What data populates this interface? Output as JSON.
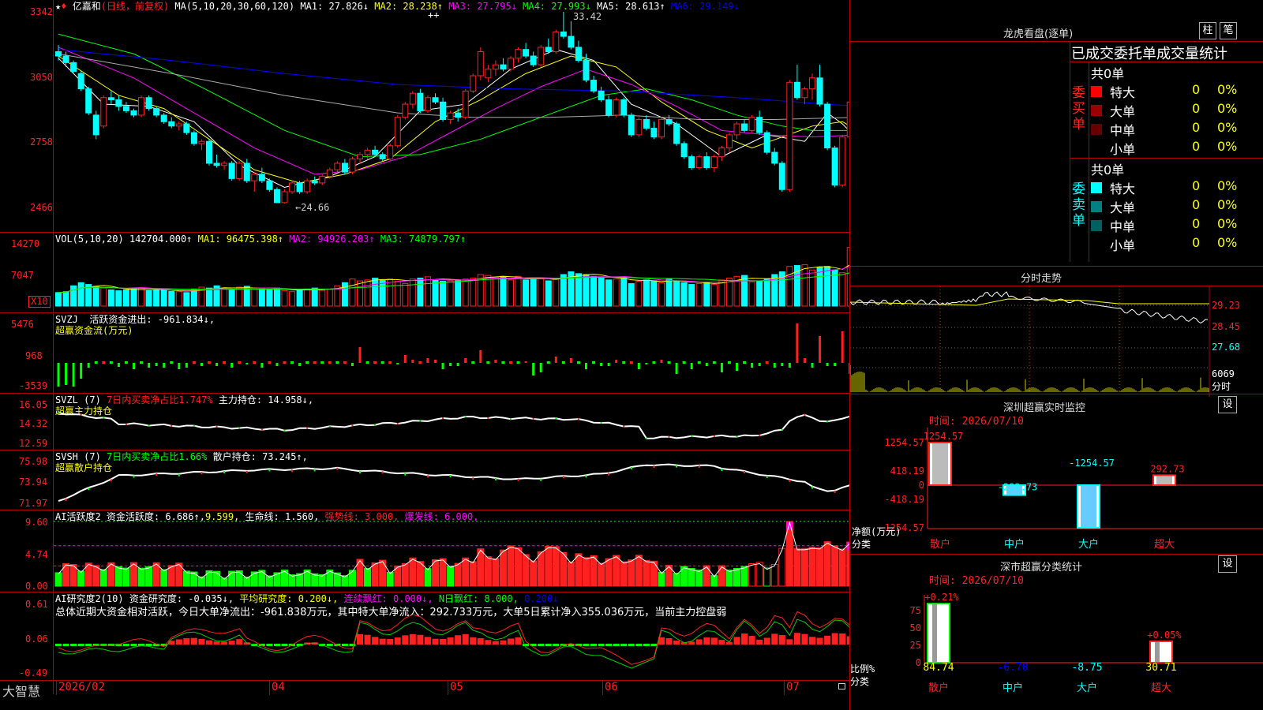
{
  "stock": {
    "name": "亿嘉和",
    "period": "(日线，前复权)",
    "ma_label": "MA(5,10,20,30,60,120)",
    "ma": [
      {
        "label": "MA1: 27.826↓",
        "color": "#ffffff"
      },
      {
        "label": "MA2: 28.238↑",
        "color": "#ffff00"
      },
      {
        "label": "MA3: 27.795↓",
        "color": "#ff00ff"
      },
      {
        "label": "MA4: 27.993↓",
        "color": "#00ff00"
      },
      {
        "label": "MA5: 28.613↑",
        "color": "#ffffff"
      },
      {
        "label": "MA6: 29.149↓",
        "color": "#0000ff"
      }
    ],
    "high_mark": "33.42",
    "low_mark": "←24.66"
  },
  "price_axis": [
    "3342",
    "3050",
    "2758",
    "2466"
  ],
  "price_chart": {
    "candles": [
      [
        31.6,
        31.9,
        31.2,
        31.4
      ],
      [
        31.4,
        31.6,
        30.9,
        31.1
      ],
      [
        31.1,
        31.2,
        30.6,
        30.7
      ],
      [
        30.6,
        30.7,
        29.8,
        29.9
      ],
      [
        29.9,
        30.0,
        28.7,
        28.8
      ],
      [
        28.7,
        28.9,
        27.6,
        27.8
      ],
      [
        28.2,
        29.6,
        28.1,
        29.5
      ],
      [
        29.5,
        29.8,
        29.2,
        29.4
      ],
      [
        29.4,
        29.6,
        28.9,
        29.1
      ],
      [
        29.1,
        29.3,
        28.8,
        28.9
      ],
      [
        28.9,
        29.0,
        28.6,
        28.7
      ],
      [
        28.7,
        29.6,
        28.6,
        29.5
      ],
      [
        29.5,
        29.6,
        28.9,
        29.0
      ],
      [
        29.0,
        29.1,
        28.6,
        28.7
      ],
      [
        28.7,
        28.8,
        28.3,
        28.4
      ],
      [
        28.4,
        28.6,
        28.1,
        28.2
      ],
      [
        28.2,
        28.4,
        28.0,
        28.3
      ],
      [
        28.3,
        28.4,
        27.8,
        27.9
      ],
      [
        27.9,
        28.0,
        27.3,
        27.4
      ],
      [
        27.4,
        27.6,
        27.1,
        27.5
      ],
      [
        27.5,
        27.6,
        26.4,
        26.5
      ],
      [
        26.5,
        26.9,
        26.3,
        26.4
      ],
      [
        26.4,
        26.6,
        26.2,
        26.5
      ],
      [
        26.5,
        26.6,
        25.7,
        25.8
      ],
      [
        25.8,
        26.6,
        25.7,
        26.5
      ],
      [
        26.5,
        26.7,
        25.6,
        25.7
      ],
      [
        25.7,
        26.1,
        25.2,
        26.0
      ],
      [
        26.0,
        26.3,
        25.6,
        25.7
      ],
      [
        25.7,
        25.8,
        25.2,
        25.3
      ],
      [
        25.3,
        25.4,
        24.7,
        24.7
      ],
      [
        24.7,
        25.3,
        24.66,
        25.2
      ],
      [
        25.2,
        25.7,
        25.1,
        25.6
      ],
      [
        25.6,
        25.7,
        25.1,
        25.2
      ],
      [
        25.2,
        25.8,
        25.1,
        25.7
      ],
      [
        25.7,
        25.9,
        25.5,
        25.6
      ],
      [
        25.6,
        26.0,
        25.5,
        25.9
      ],
      [
        25.9,
        26.3,
        25.8,
        26.2
      ],
      [
        26.2,
        26.6,
        26.1,
        26.5
      ],
      [
        26.5,
        26.7,
        26.0,
        26.1
      ],
      [
        26.1,
        26.8,
        26.0,
        26.7
      ],
      [
        26.7,
        27.0,
        26.5,
        26.9
      ],
      [
        26.9,
        27.2,
        26.7,
        27.1
      ],
      [
        27.1,
        27.3,
        26.8,
        26.9
      ],
      [
        26.9,
        27.0,
        26.6,
        26.7
      ],
      [
        26.7,
        27.4,
        26.6,
        27.3
      ],
      [
        27.3,
        28.7,
        27.2,
        28.6
      ],
      [
        28.6,
        29.3,
        28.5,
        29.2
      ],
      [
        29.2,
        29.8,
        29.0,
        29.7
      ],
      [
        29.7,
        29.9,
        28.8,
        28.9
      ],
      [
        28.9,
        29.6,
        28.8,
        29.5
      ],
      [
        29.5,
        29.7,
        29.2,
        29.3
      ],
      [
        29.3,
        29.5,
        28.4,
        28.5
      ],
      [
        28.5,
        28.9,
        28.3,
        28.8
      ],
      [
        28.8,
        29.0,
        28.4,
        28.6
      ],
      [
        28.6,
        29.9,
        28.5,
        29.8
      ],
      [
        29.8,
        30.6,
        29.7,
        30.5
      ],
      [
        30.5,
        31.8,
        30.3,
        31.6
      ],
      [
        30.4,
        31.0,
        30.2,
        30.8
      ],
      [
        30.8,
        31.2,
        30.5,
        31.0
      ],
      [
        31.0,
        31.3,
        30.7,
        30.8
      ],
      [
        30.8,
        31.4,
        30.7,
        31.3
      ],
      [
        31.3,
        31.8,
        31.1,
        31.7
      ],
      [
        31.7,
        32.0,
        31.3,
        31.4
      ],
      [
        31.4,
        31.6,
        30.9,
        31.0
      ],
      [
        31.0,
        31.9,
        30.9,
        31.8
      ],
      [
        31.8,
        32.2,
        31.5,
        31.6
      ],
      [
        31.6,
        32.6,
        31.5,
        32.5
      ],
      [
        32.5,
        33.42,
        32.2,
        32.3
      ],
      [
        32.3,
        33.0,
        31.7,
        31.8
      ],
      [
        31.8,
        32.1,
        31.1,
        31.2
      ],
      [
        31.2,
        31.5,
        30.2,
        30.3
      ],
      [
        30.3,
        30.5,
        29.7,
        29.8
      ],
      [
        29.8,
        30.0,
        29.3,
        29.4
      ],
      [
        29.4,
        29.6,
        28.6,
        28.7
      ],
      [
        28.7,
        29.5,
        28.6,
        29.4
      ],
      [
        29.4,
        29.5,
        28.6,
        28.7
      ],
      [
        28.7,
        28.8,
        27.7,
        27.8
      ],
      [
        27.8,
        28.6,
        27.7,
        28.5
      ],
      [
        28.5,
        28.7,
        28.0,
        28.1
      ],
      [
        28.1,
        28.4,
        27.6,
        27.7
      ],
      [
        27.7,
        28.6,
        27.6,
        28.5
      ],
      [
        28.5,
        28.7,
        28.2,
        28.3
      ],
      [
        28.3,
        28.4,
        27.3,
        27.4
      ],
      [
        27.4,
        27.5,
        26.7,
        26.8
      ],
      [
        26.8,
        26.9,
        26.2,
        26.3
      ],
      [
        26.3,
        26.9,
        26.2,
        26.8
      ],
      [
        26.8,
        27.0,
        26.2,
        26.3
      ],
      [
        26.3,
        26.9,
        26.1,
        26.8
      ],
      [
        26.8,
        27.3,
        26.6,
        27.2
      ],
      [
        27.2,
        27.9,
        27.0,
        27.8
      ],
      [
        27.8,
        28.4,
        27.6,
        28.3
      ],
      [
        28.3,
        28.5,
        27.9,
        28.0
      ],
      [
        28.0,
        28.7,
        27.9,
        28.6
      ],
      [
        28.6,
        28.9,
        27.8,
        27.9
      ],
      [
        27.9,
        28.0,
        26.9,
        27.0
      ],
      [
        27.0,
        27.2,
        26.4,
        26.5
      ],
      [
        26.5,
        26.6,
        25.2,
        25.3
      ],
      [
        25.3,
        30.3,
        25.2,
        30.2
      ],
      [
        30.2,
        31.0,
        29.4,
        29.5
      ],
      [
        29.5,
        30.0,
        29.2,
        29.9
      ],
      [
        29.9,
        30.6,
        29.4,
        30.4
      ],
      [
        30.4,
        31.0,
        29.1,
        29.2
      ],
      [
        29.2,
        29.3,
        27.1,
        27.2
      ],
      [
        27.2,
        27.3,
        25.4,
        25.5
      ],
      [
        25.5,
        27.8,
        25.4,
        27.7
      ],
      [
        27.7,
        29.7,
        27.5,
        29.3
      ]
    ],
    "ma_lines": [
      [
        [
          0,
          31.3
        ],
        [
          6,
          29.2
        ],
        [
          12,
          29.1
        ],
        [
          18,
          28.4
        ],
        [
          24,
          26.4
        ],
        [
          30,
          25.4
        ],
        [
          36,
          25.9
        ],
        [
          42,
          26.8
        ],
        [
          48,
          28.9
        ],
        [
          54,
          29.2
        ],
        [
          60,
          30.8
        ],
        [
          66,
          31.7
        ],
        [
          71,
          31.2
        ],
        [
          76,
          29.2
        ],
        [
          82,
          28.3
        ],
        [
          88,
          26.8
        ],
        [
          94,
          27.8
        ],
        [
          99,
          27.5
        ],
        [
          102,
          28.8
        ],
        [
          104,
          28.3
        ],
        [
          106,
          27.6
        ]
      ],
      [
        [
          0,
          31.4
        ],
        [
          8,
          29.6
        ],
        [
          14,
          29.0
        ],
        [
          20,
          27.6
        ],
        [
          26,
          26.2
        ],
        [
          32,
          25.6
        ],
        [
          38,
          26.0
        ],
        [
          44,
          26.7
        ],
        [
          50,
          28.4
        ],
        [
          56,
          29.4
        ],
        [
          62,
          30.6
        ],
        [
          68,
          31.4
        ],
        [
          74,
          30.9
        ],
        [
          80,
          29.3
        ],
        [
          86,
          28.0
        ],
        [
          92,
          27.2
        ],
        [
          96,
          27.7
        ],
        [
          100,
          28.2
        ],
        [
          104,
          28.4
        ],
        [
          106,
          28.0
        ]
      ],
      [
        [
          0,
          31.8
        ],
        [
          10,
          30.4
        ],
        [
          18,
          28.8
        ],
        [
          26,
          27.2
        ],
        [
          34,
          26.0
        ],
        [
          40,
          26.2
        ],
        [
          46,
          26.8
        ],
        [
          52,
          27.9
        ],
        [
          58,
          29.0
        ],
        [
          64,
          30.0
        ],
        [
          70,
          30.8
        ],
        [
          76,
          30.1
        ],
        [
          82,
          29.1
        ],
        [
          88,
          28.0
        ],
        [
          94,
          27.8
        ],
        [
          100,
          27.7
        ],
        [
          106,
          27.8
        ]
      ],
      [
        [
          0,
          32.4
        ],
        [
          10,
          31.5
        ],
        [
          20,
          29.8
        ],
        [
          30,
          28.0
        ],
        [
          40,
          26.8
        ],
        [
          48,
          26.9
        ],
        [
          56,
          27.6
        ],
        [
          64,
          28.6
        ],
        [
          72,
          29.6
        ],
        [
          78,
          29.9
        ],
        [
          84,
          29.4
        ],
        [
          90,
          28.7
        ],
        [
          96,
          28.2
        ],
        [
          100,
          28.0
        ],
        [
          106,
          28.0
        ]
      ],
      [
        [
          0,
          31.5
        ],
        [
          15,
          30.6
        ],
        [
          30,
          29.6
        ],
        [
          45,
          28.8
        ],
        [
          55,
          28.6
        ],
        [
          65,
          28.6
        ],
        [
          75,
          28.7
        ],
        [
          85,
          28.5
        ],
        [
          95,
          28.5
        ],
        [
          106,
          28.6
        ]
      ],
      [
        [
          0,
          31.7
        ],
        [
          15,
          31.2
        ],
        [
          30,
          30.6
        ],
        [
          45,
          30.1
        ],
        [
          60,
          29.9
        ],
        [
          75,
          29.8
        ],
        [
          90,
          29.5
        ],
        [
          106,
          29.1
        ]
      ]
    ]
  },
  "vol": {
    "label": "VOL(5,10,20)",
    "value": "142704.000↑",
    "ma": [
      {
        "label": "MA1: 96475.398↑",
        "color": "#ffff00"
      },
      {
        "label": "MA2: 94926.203↑",
        "color": "#ff00ff"
      },
      {
        "label": "MA3: 74879.797↑",
        "color": "#00ff00"
      }
    ],
    "axis": [
      "14270",
      "7047"
    ],
    "unit": "X10",
    "bars": [
      30,
      32,
      45,
      52,
      48,
      44,
      40,
      36,
      34,
      36,
      38,
      40,
      34,
      35,
      36,
      33,
      32,
      30,
      38,
      42,
      40,
      45,
      38,
      36,
      42,
      44,
      40,
      38,
      36,
      40,
      34,
      32,
      36,
      38,
      40,
      35,
      38,
      45,
      52,
      60,
      56,
      58,
      62,
      58,
      60,
      55,
      50,
      60,
      62,
      65,
      58,
      55,
      56,
      58,
      60,
      62,
      70,
      68,
      64,
      66,
      58,
      66,
      58,
      60,
      62,
      56,
      60,
      70,
      76,
      72,
      70,
      66,
      62,
      58,
      60,
      62,
      50,
      55,
      58,
      56,
      52,
      60,
      55,
      52,
      48,
      50,
      52,
      48,
      58,
      62,
      66,
      68,
      54,
      56,
      60,
      70,
      76,
      88,
      90,
      92,
      80,
      86,
      88,
      80,
      74,
      130
    ]
  },
  "svzj": {
    "name": "SVZJ",
    "text": "活跃资金进出: -961.834↓,",
    "sub": "超赢资金流(万元)",
    "axis": [
      "5476",
      "968",
      "-3539"
    ],
    "bars": [
      -1,
      -1,
      -3,
      -3,
      -2,
      -1,
      0,
      0,
      0,
      0,
      0,
      0,
      -1,
      0,
      0,
      0,
      -1,
      0,
      0,
      -1,
      -1,
      0,
      0,
      0,
      0,
      0,
      0,
      0,
      0,
      0,
      0,
      0,
      0,
      0,
      0,
      0,
      0,
      0,
      0,
      0,
      0,
      0,
      0,
      0,
      0,
      0,
      0,
      0,
      0,
      0,
      0,
      0,
      0,
      0,
      0,
      0,
      0,
      0,
      0,
      0,
      0,
      0,
      0,
      0,
      0,
      0,
      0,
      0,
      0,
      0,
      0,
      0,
      0,
      0,
      0,
      0,
      0,
      0,
      0,
      0,
      0,
      0,
      0,
      0,
      0,
      0,
      0,
      0,
      0,
      0,
      0,
      0,
      0,
      0,
      0,
      0,
      0,
      0,
      0,
      0,
      0,
      0,
      0,
      0,
      0,
      0
    ]
  },
  "svzl": {
    "name": "SVZL (7)",
    "pct": "7日内买卖净占比1.747%",
    "main": "主力持仓: 14.958↓,",
    "sub": "超赢主力持仓",
    "axis": [
      "16.05",
      "14.32",
      "12.59"
    ]
  },
  "svsh": {
    "name": "SVSH (7)",
    "pct": "7日内买卖净占比1.66%",
    "main": "散户持仓: 73.245↑,",
    "sub": "超赢散户持仓",
    "axis": [
      "75.98",
      "73.94",
      "71.97"
    ]
  },
  "ai": {
    "name": "AI活跃度2",
    "val1": "资金活跃度: 6.686↑,",
    "val2": "9.599,",
    "val3": "生命线: 1.560,",
    "val4": "强势线: 3.000,",
    "val5": "爆发线: 6.000,",
    "axis": [
      "9.60",
      "4.74",
      "0.00"
    ]
  },
  "research": {
    "name": "AI研究度2(10)",
    "val1": "资金研究度: -0.035↓,",
    "val2": "平均研究度: 0.200↓,",
    "val3": "连续飘红: 0.000↓,",
    "val4": "N日飘红: 8.000,",
    "val5": "0.200↓",
    "summary": "总体近期大资金相对活跃，今日大单净流出：-961.838万元，其中特大单净流入：292.733万元，大单5日累计净入355.036万元，当前主力控盘弱",
    "axis": [
      "0.61",
      "0.06",
      "-0.49"
    ]
  },
  "bottom": {
    "brand": "大智慧",
    "months": [
      "2026/02",
      "04",
      "05",
      "06",
      "07"
    ]
  },
  "sidebar": {
    "title": "龙虎看盘(逐单)",
    "btn1": "柱",
    "btn2": "笔",
    "table_header": "已成交委托单成交量统计",
    "buy": {
      "label": "委买单",
      "total": "共0单",
      "rows": [
        {
          "label": "特大",
          "val": "0",
          "pct": "0%",
          "color": "#ff0000"
        },
        {
          "label": "大单",
          "val": "0",
          "pct": "0%",
          "color": "#990000"
        },
        {
          "label": "中单",
          "val": "0",
          "pct": "0%",
          "color": "#660000"
        },
        {
          "label": "小单",
          "val": "0",
          "pct": "0%",
          "color": ""
        }
      ]
    },
    "sell": {
      "label": "委卖单",
      "total": "共0单",
      "rows": [
        {
          "label": "特大",
          "val": "0",
          "pct": "0%",
          "color": "#00ffff"
        },
        {
          "label": "大单",
          "val": "0",
          "pct": "0%",
          "color": "#008080"
        },
        {
          "label": "中单",
          "val": "0",
          "pct": "0%",
          "color": "#006060"
        },
        {
          "label": "小单",
          "val": "0",
          "pct": "0%",
          "color": ""
        }
      ]
    },
    "intraday": {
      "title": "分时走势",
      "axis": [
        "29.23",
        "28.45",
        "27.68",
        "6069",
        "分时"
      ]
    },
    "monitor": {
      "title": "深圳超赢实时监控",
      "btn": "设",
      "time": "时间: 2026/07/10",
      "axis": [
        "1254.57",
        "418.19",
        "0",
        "-418.19",
        "-1254.57"
      ],
      "ylabel": "净额(万元)",
      "xlabel": "分类",
      "bars": [
        {
          "cat": "散户",
          "value": 1254.57,
          "label": "1254.57"
        },
        {
          "cat": "中户",
          "value": -292.73,
          "label": "-292.73"
        },
        {
          "cat": "大户",
          "value": -1254.57,
          "label": "-1254.57"
        },
        {
          "cat": "超大",
          "value": 292.73,
          "label": "292.73"
        }
      ]
    },
    "stats": {
      "title": "深市超赢分类统计",
      "btn": "设",
      "time": "时间: 2026/07/10",
      "axis": [
        "75",
        "50",
        "25",
        "0"
      ],
      "ylabel": "比例%",
      "xlabel": "分类",
      "top_labels": [
        "+0.21%",
        "",
        "",
        "+0.05%"
      ],
      "bars": [
        {
          "cat": "散户",
          "value": 84.74,
          "label": "84.74"
        },
        {
          "cat": "中户",
          "value": -6.7,
          "label": "-6.70"
        },
        {
          "cat": "大户",
          "value": -8.75,
          "label": "-8.75"
        },
        {
          "cat": "超大",
          "value": 30.71,
          "label": "30.71"
        }
      ]
    }
  }
}
